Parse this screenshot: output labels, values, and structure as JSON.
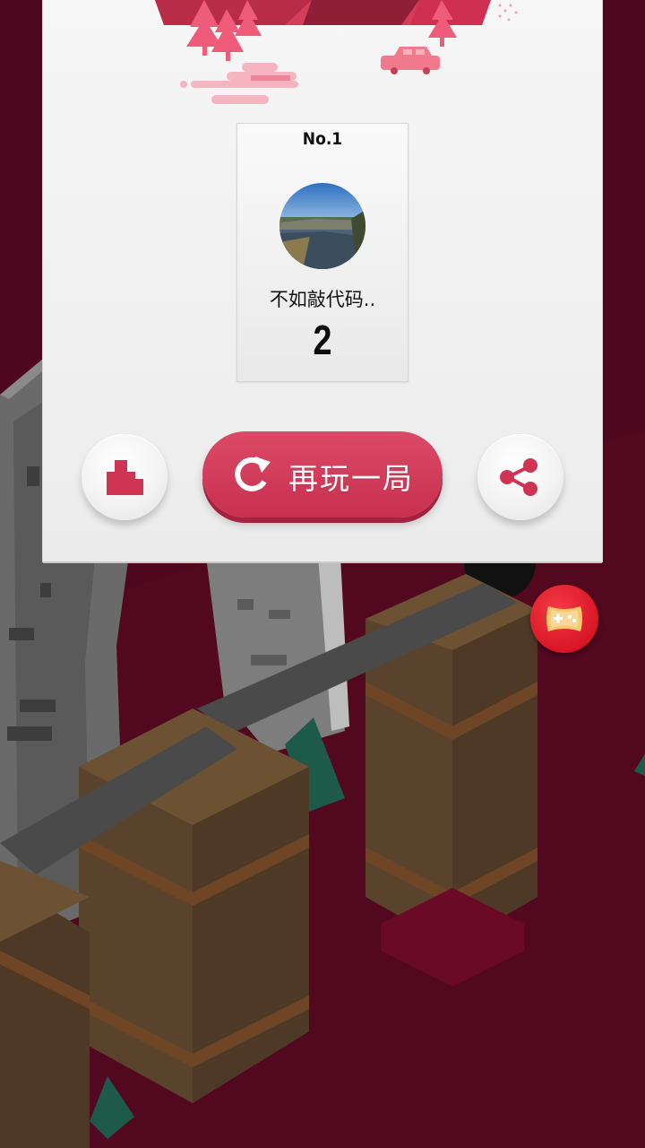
{
  "colors": {
    "background": "#4f0720",
    "accent": "#d23b5a",
    "panel": "#f2f2f2",
    "text": "#111111"
  },
  "result_panel": {
    "rank_card": {
      "rank_label": "No.1",
      "player_name": "不如敲代码..",
      "score": "2",
      "avatar": "landscape-photo-avatar"
    },
    "buttons": {
      "leaderboard_icon": "leaderboard-blocks-icon",
      "replay_icon": "replay-arrow-icon",
      "replay_label": "再玩一局",
      "share_icon": "share-icon"
    }
  },
  "floating": {
    "game_center_icon": "gamepad-icon"
  }
}
